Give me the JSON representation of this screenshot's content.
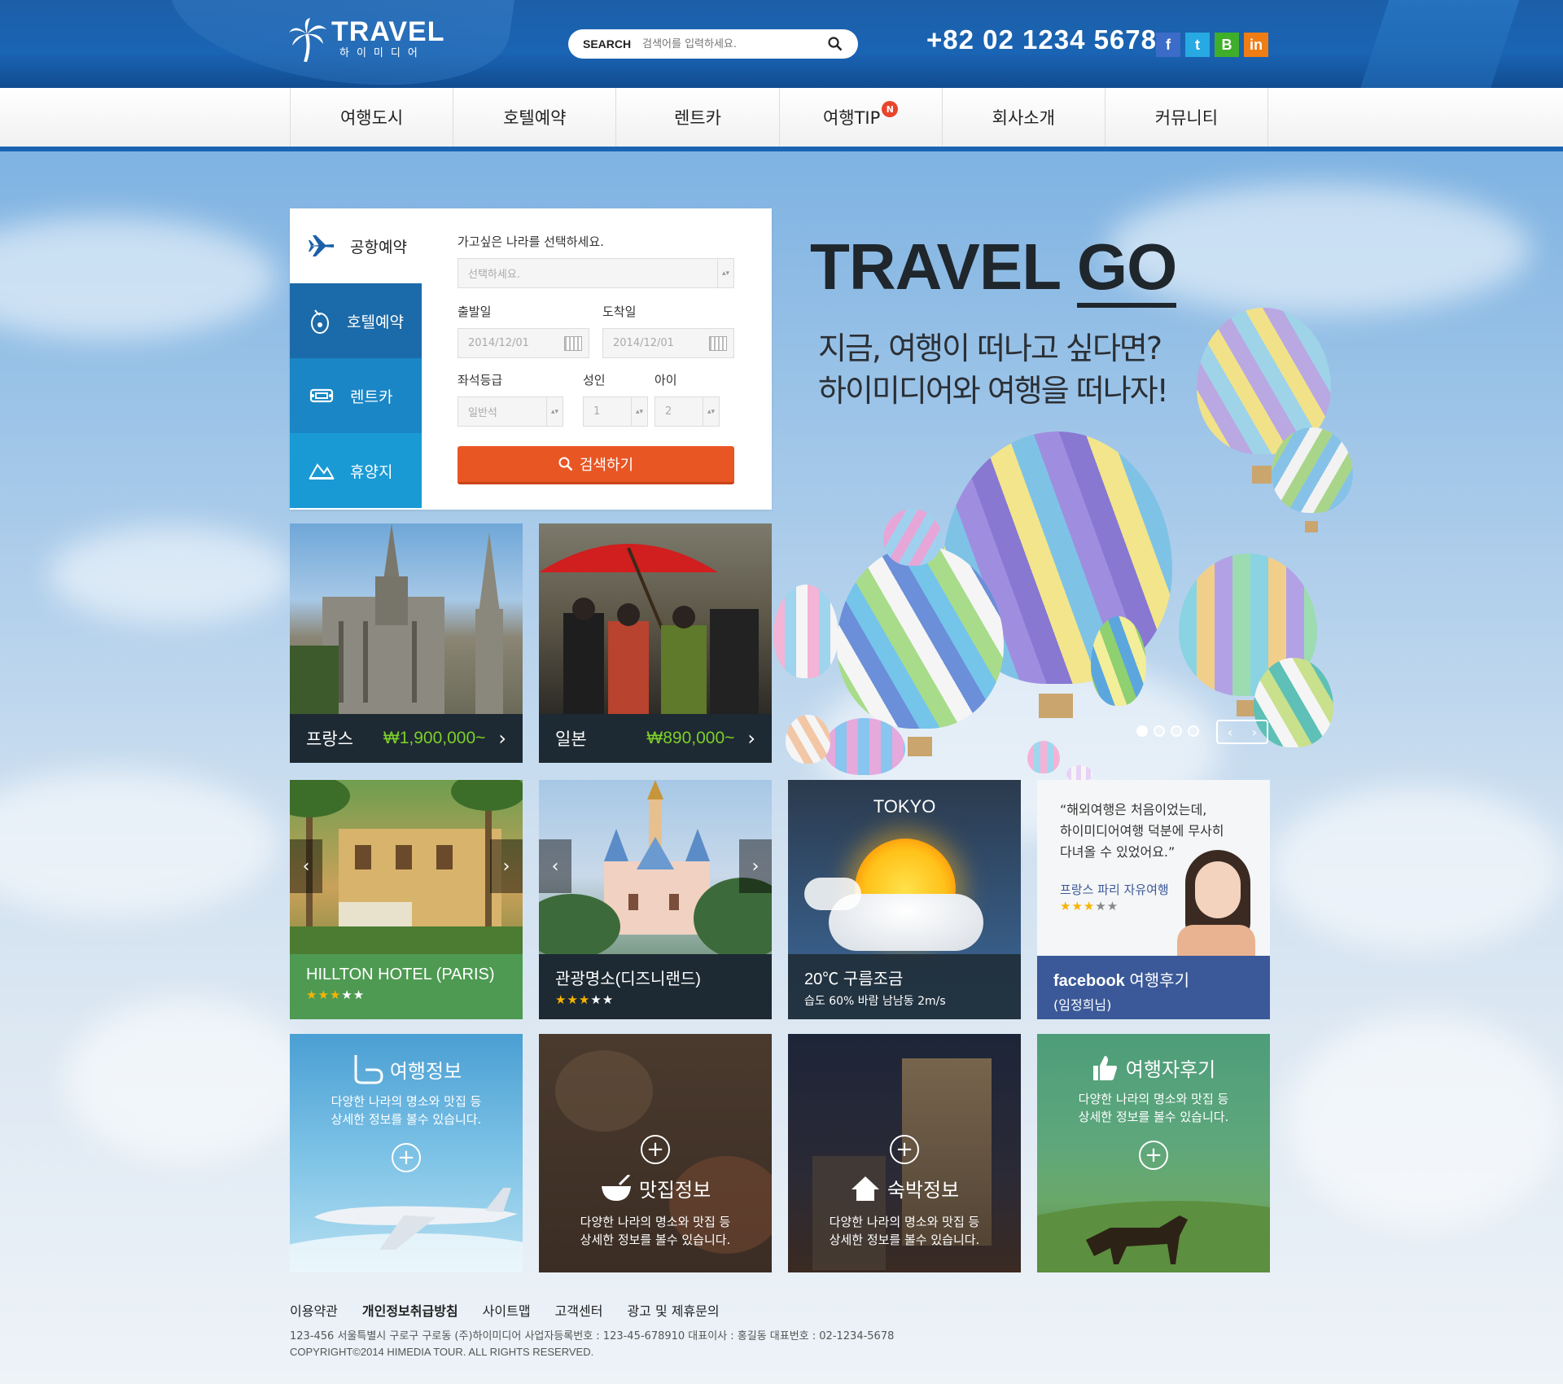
{
  "header": {
    "logo_main": "TRAVEL",
    "logo_sub": "하이미디어",
    "search_label": "SEARCH",
    "search_placeholder": "검색어를 입력하세요.",
    "phone": "+82 02 1234 5678",
    "social": [
      "f",
      "t",
      "B",
      "in"
    ]
  },
  "nav": {
    "items": [
      "여행도시",
      "호텔예약",
      "렌트카",
      "여행TIP",
      "회사소개",
      "커뮤니티"
    ],
    "badge": "N"
  },
  "booking": {
    "tabs": [
      "공항예약",
      "호텔예약",
      "렌트카",
      "휴양지"
    ],
    "country_label": "가고싶은 나라를 선택하세요.",
    "country_value": "선택하세요.",
    "depart_label": "출발일",
    "depart_value": "2014/12/01",
    "arrive_label": "도착일",
    "arrive_value": "2014/12/01",
    "seat_label": "좌석등급",
    "seat_value": "일반석",
    "adult_label": "성인",
    "adult_value": "1",
    "child_label": "아이",
    "child_value": "2",
    "search_button": "검색하기"
  },
  "hero": {
    "title_a": "TRAVEL",
    "title_b": "GO",
    "subtitle_1": "지금, 여행이 떠나고 싶다면?",
    "subtitle_2": "하이미디어와 여행을 떠나자!",
    "prev": "‹",
    "next": "›"
  },
  "destinations": [
    {
      "name": "프랑스",
      "price": "₩1,900,000~"
    },
    {
      "name": "일본",
      "price": "₩890,000~"
    }
  ],
  "features": {
    "hotel": {
      "title": "HILLTON HOTEL (PARIS)",
      "rating": 3,
      "color": "#4e9a52"
    },
    "attraction": {
      "title": "관광명소(디즈니랜드)",
      "rating": 3
    },
    "weather": {
      "city": "TOKYO",
      "temp": "20℃ 구름조금",
      "detail": "습도 60% 바람 남남동 2m/s"
    },
    "review": {
      "quote_1": "“해외여행은 처음이었는데,",
      "quote_2": "하이미디어여행 덕분에 무사히",
      "quote_3": "다녀올 수 있었어요.”",
      "trip": "프랑스 파리 자유여행",
      "rating": 3,
      "source_a": "facebook",
      "source_b": "여행후기",
      "author": "(임정희님)",
      "color": "#3b5998"
    }
  },
  "tiles": [
    {
      "title": "여행정보",
      "desc_1": "다양한 나라의 명소와 맛집 등",
      "desc_2": "상세한 정보를 볼수 있습니다."
    },
    {
      "title": "맛집정보",
      "desc_1": "다양한 나라의 명소와 맛집 등",
      "desc_2": "상세한 정보를 볼수 있습니다."
    },
    {
      "title": "숙박정보",
      "desc_1": "다양한 나라의 명소와 맛집 등",
      "desc_2": "상세한 정보를 볼수 있습니다."
    },
    {
      "title": "여행자후기",
      "desc_1": "다양한 나라의 명소와 맛집 등",
      "desc_2": "상세한 정보를 볼수 있습니다."
    }
  ],
  "footer": {
    "links": [
      "이용약관",
      "개인정보취급방침",
      "사이트맵",
      "고객센터",
      "광고 및 제휴문의"
    ],
    "address": "123-456 서울특별시 구로구 구로동 (주)하이미디어   사업자등록번호 : 123-45-678910   대표이사 : 홍길동   대표번호 : 02-1234-5678",
    "copyright": "COPYRIGHT©2014 HIMEDIA TOUR. ALL RIGHTS RESERVED."
  },
  "colors": {
    "brand_blue": "#1b64b3",
    "search_orange": "#e85624",
    "price_green": "#7ccf2a"
  }
}
